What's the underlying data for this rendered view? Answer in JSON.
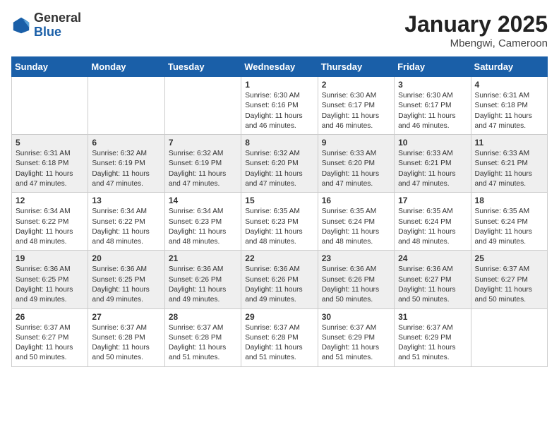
{
  "header": {
    "logo_general": "General",
    "logo_blue": "Blue",
    "title": "January 2025",
    "location": "Mbengwi, Cameroon"
  },
  "days_of_week": [
    "Sunday",
    "Monday",
    "Tuesday",
    "Wednesday",
    "Thursday",
    "Friday",
    "Saturday"
  ],
  "weeks": [
    [
      {
        "num": "",
        "info": ""
      },
      {
        "num": "",
        "info": ""
      },
      {
        "num": "",
        "info": ""
      },
      {
        "num": "1",
        "info": "Sunrise: 6:30 AM\nSunset: 6:16 PM\nDaylight: 11 hours\nand 46 minutes."
      },
      {
        "num": "2",
        "info": "Sunrise: 6:30 AM\nSunset: 6:17 PM\nDaylight: 11 hours\nand 46 minutes."
      },
      {
        "num": "3",
        "info": "Sunrise: 6:30 AM\nSunset: 6:17 PM\nDaylight: 11 hours\nand 46 minutes."
      },
      {
        "num": "4",
        "info": "Sunrise: 6:31 AM\nSunset: 6:18 PM\nDaylight: 11 hours\nand 47 minutes."
      }
    ],
    [
      {
        "num": "5",
        "info": "Sunrise: 6:31 AM\nSunset: 6:18 PM\nDaylight: 11 hours\nand 47 minutes."
      },
      {
        "num": "6",
        "info": "Sunrise: 6:32 AM\nSunset: 6:19 PM\nDaylight: 11 hours\nand 47 minutes."
      },
      {
        "num": "7",
        "info": "Sunrise: 6:32 AM\nSunset: 6:19 PM\nDaylight: 11 hours\nand 47 minutes."
      },
      {
        "num": "8",
        "info": "Sunrise: 6:32 AM\nSunset: 6:20 PM\nDaylight: 11 hours\nand 47 minutes."
      },
      {
        "num": "9",
        "info": "Sunrise: 6:33 AM\nSunset: 6:20 PM\nDaylight: 11 hours\nand 47 minutes."
      },
      {
        "num": "10",
        "info": "Sunrise: 6:33 AM\nSunset: 6:21 PM\nDaylight: 11 hours\nand 47 minutes."
      },
      {
        "num": "11",
        "info": "Sunrise: 6:33 AM\nSunset: 6:21 PM\nDaylight: 11 hours\nand 47 minutes."
      }
    ],
    [
      {
        "num": "12",
        "info": "Sunrise: 6:34 AM\nSunset: 6:22 PM\nDaylight: 11 hours\nand 48 minutes."
      },
      {
        "num": "13",
        "info": "Sunrise: 6:34 AM\nSunset: 6:22 PM\nDaylight: 11 hours\nand 48 minutes."
      },
      {
        "num": "14",
        "info": "Sunrise: 6:34 AM\nSunset: 6:23 PM\nDaylight: 11 hours\nand 48 minutes."
      },
      {
        "num": "15",
        "info": "Sunrise: 6:35 AM\nSunset: 6:23 PM\nDaylight: 11 hours\nand 48 minutes."
      },
      {
        "num": "16",
        "info": "Sunrise: 6:35 AM\nSunset: 6:24 PM\nDaylight: 11 hours\nand 48 minutes."
      },
      {
        "num": "17",
        "info": "Sunrise: 6:35 AM\nSunset: 6:24 PM\nDaylight: 11 hours\nand 48 minutes."
      },
      {
        "num": "18",
        "info": "Sunrise: 6:35 AM\nSunset: 6:24 PM\nDaylight: 11 hours\nand 49 minutes."
      }
    ],
    [
      {
        "num": "19",
        "info": "Sunrise: 6:36 AM\nSunset: 6:25 PM\nDaylight: 11 hours\nand 49 minutes."
      },
      {
        "num": "20",
        "info": "Sunrise: 6:36 AM\nSunset: 6:25 PM\nDaylight: 11 hours\nand 49 minutes."
      },
      {
        "num": "21",
        "info": "Sunrise: 6:36 AM\nSunset: 6:26 PM\nDaylight: 11 hours\nand 49 minutes."
      },
      {
        "num": "22",
        "info": "Sunrise: 6:36 AM\nSunset: 6:26 PM\nDaylight: 11 hours\nand 49 minutes."
      },
      {
        "num": "23",
        "info": "Sunrise: 6:36 AM\nSunset: 6:26 PM\nDaylight: 11 hours\nand 50 minutes."
      },
      {
        "num": "24",
        "info": "Sunrise: 6:36 AM\nSunset: 6:27 PM\nDaylight: 11 hours\nand 50 minutes."
      },
      {
        "num": "25",
        "info": "Sunrise: 6:37 AM\nSunset: 6:27 PM\nDaylight: 11 hours\nand 50 minutes."
      }
    ],
    [
      {
        "num": "26",
        "info": "Sunrise: 6:37 AM\nSunset: 6:27 PM\nDaylight: 11 hours\nand 50 minutes."
      },
      {
        "num": "27",
        "info": "Sunrise: 6:37 AM\nSunset: 6:28 PM\nDaylight: 11 hours\nand 50 minutes."
      },
      {
        "num": "28",
        "info": "Sunrise: 6:37 AM\nSunset: 6:28 PM\nDaylight: 11 hours\nand 51 minutes."
      },
      {
        "num": "29",
        "info": "Sunrise: 6:37 AM\nSunset: 6:28 PM\nDaylight: 11 hours\nand 51 minutes."
      },
      {
        "num": "30",
        "info": "Sunrise: 6:37 AM\nSunset: 6:29 PM\nDaylight: 11 hours\nand 51 minutes."
      },
      {
        "num": "31",
        "info": "Sunrise: 6:37 AM\nSunset: 6:29 PM\nDaylight: 11 hours\nand 51 minutes."
      },
      {
        "num": "",
        "info": ""
      }
    ]
  ]
}
